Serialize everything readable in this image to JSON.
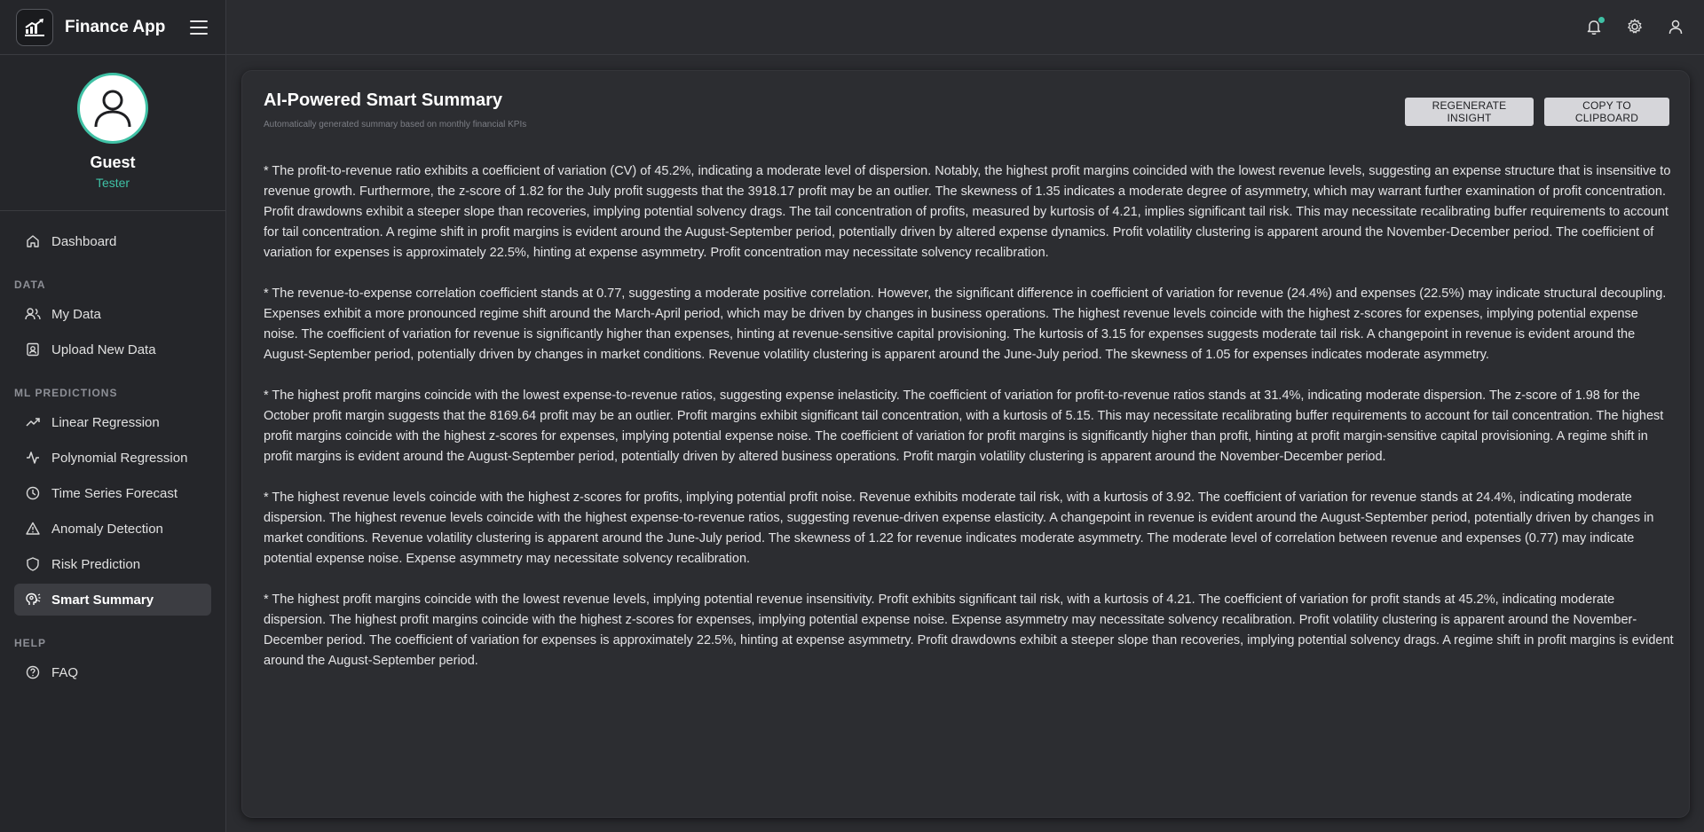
{
  "app": {
    "title": "Finance App"
  },
  "user": {
    "name": "Guest",
    "role": "Tester"
  },
  "sidebar": {
    "items": [
      {
        "label": "Dashboard",
        "icon": "home-icon"
      }
    ],
    "sections": [
      {
        "title": "DATA",
        "items": [
          {
            "label": "My Data",
            "icon": "users-icon"
          },
          {
            "label": "Upload New Data",
            "icon": "contact-card-icon"
          }
        ]
      },
      {
        "title": "ML PREDICTIONS",
        "items": [
          {
            "label": "Linear Regression",
            "icon": "trend-up-icon"
          },
          {
            "label": "Polynomial Regression",
            "icon": "activity-icon"
          },
          {
            "label": "Time Series Forecast",
            "icon": "clock-icon"
          },
          {
            "label": "Anomaly Detection",
            "icon": "warning-icon"
          },
          {
            "label": "Risk Prediction",
            "icon": "shield-icon"
          },
          {
            "label": "Smart Summary",
            "icon": "brain-icon",
            "active": true
          }
        ]
      },
      {
        "title": "HELP",
        "items": [
          {
            "label": "FAQ",
            "icon": "help-circle-icon"
          }
        ]
      }
    ]
  },
  "topbar": {
    "icons": [
      "bell-icon",
      "gear-icon",
      "user-icon"
    ],
    "accent": "#3fc1a5"
  },
  "card": {
    "title": "AI-Powered Smart Summary",
    "subtitle": "Automatically generated summary based on monthly financial KPIs",
    "regenerate_label": "REGENERATE INSIGHT",
    "copy_label": "COPY TO CLIPBOARD",
    "paragraphs": [
      "* The profit-to-revenue ratio exhibits a coefficient of variation (CV) of 45.2%, indicating a moderate level of dispersion. Notably, the highest profit margins coincided with the lowest revenue levels, suggesting an expense structure that is insensitive to revenue growth. Furthermore, the z-score of 1.82 for the July profit suggests that the 3918.17 profit may be an outlier. The skewness of 1.35 indicates a moderate degree of asymmetry, which may warrant further examination of profit concentration. Profit drawdowns exhibit a steeper slope than recoveries, implying potential solvency drags. The tail concentration of profits, measured by kurtosis of 4.21, implies significant tail risk. This may necessitate recalibrating buffer requirements to account for tail concentration. A regime shift in profit margins is evident around the August-September period, potentially driven by altered expense dynamics. Profit volatility clustering is apparent around the November-December period. The coefficient of variation for expenses is approximately 22.5%, hinting at expense asymmetry. Profit concentration may necessitate solvency recalibration.",
      "* The revenue-to-expense correlation coefficient stands at 0.77, suggesting a moderate positive correlation. However, the significant difference in coefficient of variation for revenue (24.4%) and expenses (22.5%) may indicate structural decoupling. Expenses exhibit a more pronounced regime shift around the March-April period, which may be driven by changes in business operations. The highest revenue levels coincide with the highest z-scores for expenses, implying potential expense noise. The coefficient of variation for revenue is significantly higher than expenses, hinting at revenue-sensitive capital provisioning. The kurtosis of 3.15 for expenses suggests moderate tail risk. A changepoint in revenue is evident around the August-September period, potentially driven by changes in market conditions. Revenue volatility clustering is apparent around the June-July period. The skewness of 1.05 for expenses indicates moderate asymmetry.",
      "* The highest profit margins coincide with the lowest expense-to-revenue ratios, suggesting expense inelasticity. The coefficient of variation for profit-to-revenue ratios stands at 31.4%, indicating moderate dispersion. The z-score of 1.98 for the October profit margin suggests that the 8169.64 profit may be an outlier. Profit margins exhibit significant tail concentration, with a kurtosis of 5.15. This may necessitate recalibrating buffer requirements to account for tail concentration. The highest profit margins coincide with the highest z-scores for expenses, implying potential expense noise. The coefficient of variation for profit margins is significantly higher than profit, hinting at profit margin-sensitive capital provisioning. A regime shift in profit margins is evident around the August-September period, potentially driven by altered business operations. Profit margin volatility clustering is apparent around the November-December period.",
      "* The highest revenue levels coincide with the highest z-scores for profits, implying potential profit noise. Revenue exhibits moderate tail risk, with a kurtosis of 3.92. The coefficient of variation for revenue stands at 24.4%, indicating moderate dispersion. The highest revenue levels coincide with the highest expense-to-revenue ratios, suggesting revenue-driven expense elasticity. A changepoint in revenue is evident around the August-September period, potentially driven by changes in market conditions. Revenue volatility clustering is apparent around the June-July period. The skewness of 1.22 for revenue indicates moderate asymmetry. The moderate level of correlation between revenue and expenses (0.77) may indicate potential expense noise. Expense asymmetry may necessitate solvency recalibration.",
      "* The highest profit margins coincide with the lowest revenue levels, implying potential revenue insensitivity. Profit exhibits significant tail risk, with a kurtosis of 4.21. The coefficient of variation for profit stands at 45.2%, indicating moderate dispersion. The highest profit margins coincide with the highest z-scores for expenses, implying potential expense noise. Expense asymmetry may necessitate solvency recalibration. Profit volatility clustering is apparent around the November-December period. The coefficient of variation for expenses is approximately 22.5%, hinting at expense asymmetry. Profit drawdowns exhibit a steeper slope than recoveries, implying potential solvency drags. A regime shift in profit margins is evident around the August-September period."
    ]
  }
}
